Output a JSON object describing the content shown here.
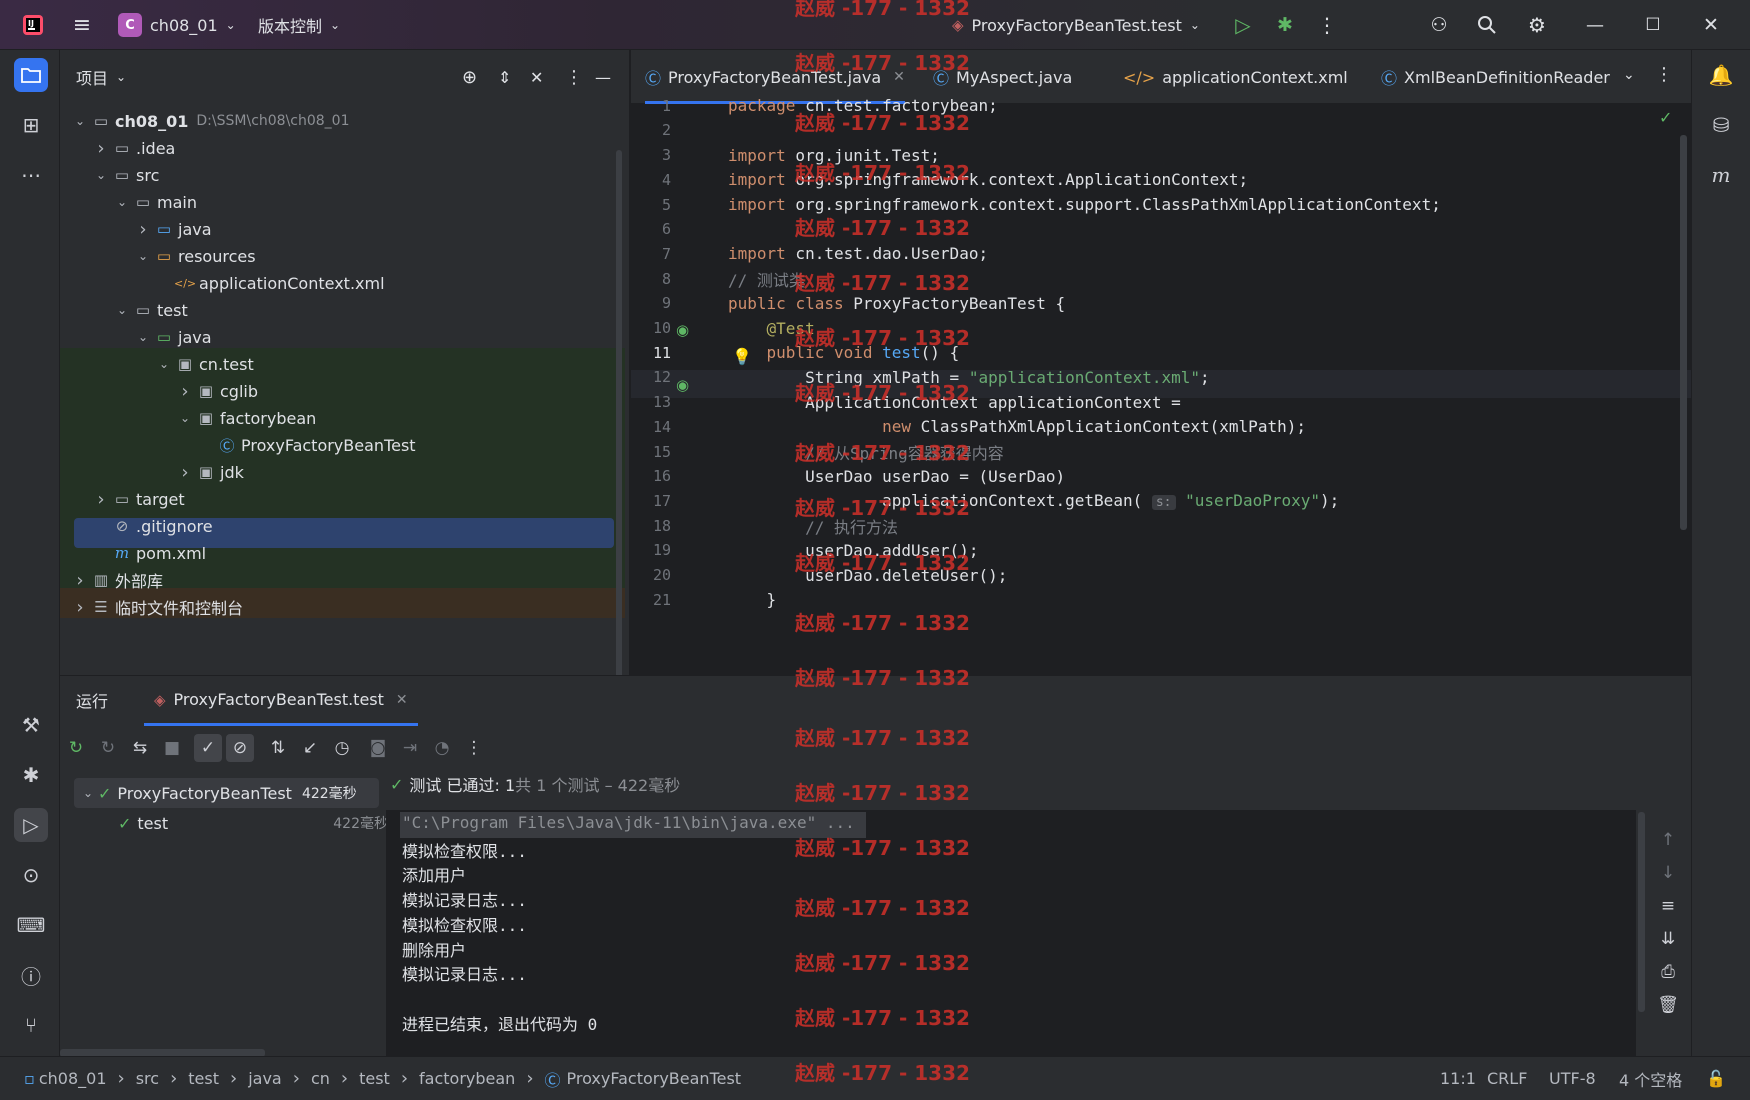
{
  "titlebar": {
    "project_badge": "C",
    "project_name": "ch08_01",
    "vcs_label": "版本控制",
    "run_config": "ProxyFactoryBeanTest.test"
  },
  "project_panel": {
    "title": "项目",
    "tree": [
      {
        "label": "ch08_01",
        "path": "D:\\SSM\\ch08\\ch08_01",
        "depth": 0,
        "chev": "v",
        "icon": "module-folder-icon"
      },
      {
        "label": ".idea",
        "depth": 1,
        "chev": ">",
        "icon": "folder-icon"
      },
      {
        "label": "src",
        "depth": 1,
        "chev": "v",
        "icon": "folder-icon"
      },
      {
        "label": "main",
        "depth": 2,
        "chev": "v",
        "icon": "folder-icon"
      },
      {
        "label": "java",
        "depth": 3,
        "chev": ">",
        "icon": "source-folder-icon"
      },
      {
        "label": "resources",
        "depth": 3,
        "chev": "v",
        "icon": "resources-folder-icon"
      },
      {
        "label": "applicationContext.xml",
        "depth": 4,
        "chev": "",
        "icon": "xml-file-icon"
      },
      {
        "label": "test",
        "depth": 2,
        "chev": "v",
        "icon": "folder-icon"
      },
      {
        "label": "java",
        "depth": 3,
        "chev": "v",
        "icon": "test-folder-icon"
      },
      {
        "label": "cn.test",
        "depth": 4,
        "chev": "v",
        "icon": "package-icon"
      },
      {
        "label": "cglib",
        "depth": 5,
        "chev": ">",
        "icon": "package-icon"
      },
      {
        "label": "factorybean",
        "depth": 5,
        "chev": "v",
        "icon": "package-icon"
      },
      {
        "label": "ProxyFactoryBeanTest",
        "depth": 6,
        "chev": "",
        "icon": "class-icon"
      },
      {
        "label": "jdk",
        "depth": 5,
        "chev": ">",
        "icon": "package-icon"
      },
      {
        "label": "target",
        "depth": 1,
        "chev": ">",
        "icon": "folder-icon"
      },
      {
        "label": ".gitignore",
        "depth": 1,
        "chev": "",
        "icon": "ignore-file-icon"
      },
      {
        "label": "pom.xml",
        "depth": 1,
        "chev": "",
        "icon": "maven-icon"
      },
      {
        "label": "外部库",
        "depth": 0,
        "chev": ">",
        "icon": "library-icon"
      },
      {
        "label": "临时文件和控制台",
        "depth": 0,
        "chev": ">",
        "icon": "scratch-icon"
      }
    ]
  },
  "editor": {
    "tabs": [
      {
        "label": "ProxyFactoryBeanTest.java",
        "active": true,
        "icon": "class-icon"
      },
      {
        "label": "MyAspect.java",
        "active": false,
        "icon": "class-icon"
      },
      {
        "label": "applicationContext.xml",
        "active": false,
        "icon": "xml-file-icon"
      },
      {
        "label": "XmlBeanDefinitionReader",
        "active": false,
        "icon": "class-icon"
      }
    ],
    "lines": [
      {
        "n": "1",
        "code": "package cn.test.factorybean;"
      },
      {
        "n": "2",
        "code": ""
      },
      {
        "n": "3",
        "code": "import org.junit.Test;"
      },
      {
        "n": "4",
        "code": "import org.springframework.context.ApplicationContext;"
      },
      {
        "n": "5",
        "code": "import org.springframework.context.support.ClassPathXmlApplicationContext;"
      },
      {
        "n": "6",
        "code": ""
      },
      {
        "n": "7",
        "code": "import cn.test.dao.UserDao;"
      },
      {
        "n": "8",
        "code": "// 测试类"
      },
      {
        "n": "9",
        "code": "public class ProxyFactoryBeanTest {"
      },
      {
        "n": "10",
        "code": "    @Test"
      },
      {
        "n": "11",
        "code": "    public void test() {"
      },
      {
        "n": "12",
        "code": "        String xmlPath = \"applicationContext.xml\";"
      },
      {
        "n": "13",
        "code": "        ApplicationContext applicationContext ="
      },
      {
        "n": "14",
        "code": "                new ClassPathXmlApplicationContext(xmlPath);"
      },
      {
        "n": "15",
        "code": "        // 从Spring容器获得内容"
      },
      {
        "n": "16",
        "code": "        UserDao userDao = (UserDao)"
      },
      {
        "n": "17",
        "code": "                applicationContext.getBean( s: \"userDaoProxy\");"
      },
      {
        "n": "18",
        "code": "        // 执行方法"
      },
      {
        "n": "19",
        "code": "        userDao.addUser();"
      },
      {
        "n": "20",
        "code": "        userDao.deleteUser();"
      },
      {
        "n": "21",
        "code": "    }"
      }
    ]
  },
  "run_panel": {
    "title": "运行",
    "tab": "ProxyFactoryBeanTest.test",
    "tree": [
      {
        "label": "ProxyFactoryBeanTest",
        "time": "422毫秒"
      },
      {
        "label": "test",
        "time": "422毫秒"
      }
    ],
    "summary_prefix": "测试 已通过: 1",
    "summary_suffix": "共 1 个测试 – 422毫秒",
    "console": [
      "\"C:\\Program Files\\Java\\jdk-11\\bin\\java.exe\" ...",
      "模拟检查权限...",
      "添加用户",
      "模拟记录日志...",
      "模拟检查权限...",
      "删除用户",
      "模拟记录日志...",
      "",
      "进程已结束，退出代码为 0"
    ]
  },
  "statusbar": {
    "breadcrumbs": [
      "ch08_01",
      "src",
      "test",
      "java",
      "cn",
      "test",
      "factorybean",
      "ProxyFactoryBeanTest"
    ],
    "position": "11:1",
    "line_sep": "CRLF",
    "encoding": "UTF-8",
    "indent": "4 个空格"
  },
  "watermark": "赵威 -177 - 1332",
  "colors": {
    "accent": "#3574f0",
    "pass": "#5fb865",
    "keyword": "#cf8e6d",
    "string": "#6aab73"
  }
}
